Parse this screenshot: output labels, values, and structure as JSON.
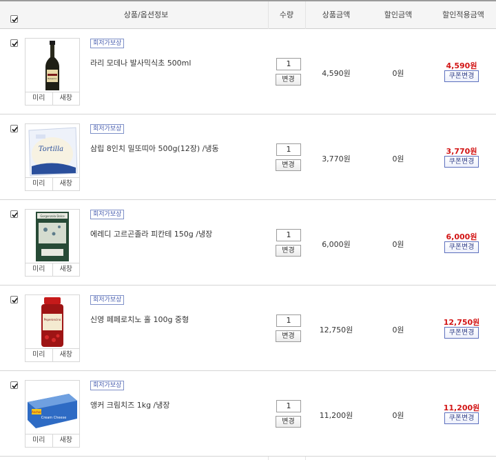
{
  "header": {
    "product_info": "상품/옵션정보",
    "quantity": "수량",
    "product_amount": "상품금액",
    "discount_amount": "할인금액",
    "final_amount": "할인적용금액"
  },
  "row_labels": {
    "preview": "미리",
    "wishlist": "새창",
    "change": "변경",
    "coupon_change": "쿠폰변경"
  },
  "items": [
    {
      "badge": "회저가보상",
      "name": "라리 모데나 발사믹식초 500ml",
      "qty": "1",
      "price": "4,590원",
      "discount": "0원",
      "final": "4,590원"
    },
    {
      "badge": "회저가보상",
      "name": "삼립 8인치 밀또띠아 500g(12장) /냉동",
      "qty": "1",
      "price": "3,770원",
      "discount": "0원",
      "final": "3,770원"
    },
    {
      "badge": "회저가보상",
      "name": "에레디 고르곤졸라 피칸테 150g /냉장",
      "qty": "1",
      "price": "6,000원",
      "discount": "0원",
      "final": "6,000원"
    },
    {
      "badge": "회저가보상",
      "name": "신영 페페로치노 홀 100g 중형",
      "qty": "1",
      "price": "12,750원",
      "discount": "0원",
      "final": "12,750원"
    },
    {
      "badge": "회저가보상",
      "name": "앵커 크림치즈 1kg /냉장",
      "qty": "1",
      "price": "11,200원",
      "discount": "0원",
      "final": "11,200원"
    }
  ],
  "product_images": {
    "item0": "Balsamic",
    "item1": "Tortilla",
    "item2": "Gorgonzola Dolce",
    "item3": "Peperoncino",
    "item4": "Anchor",
    "item4_sub": "Cream Cheese"
  },
  "colors": {
    "final_price": "#d21414",
    "badge_border": "#7d8fc7",
    "coupon_border": "#5b6fbd",
    "header_bg": "#f5f5f5"
  }
}
